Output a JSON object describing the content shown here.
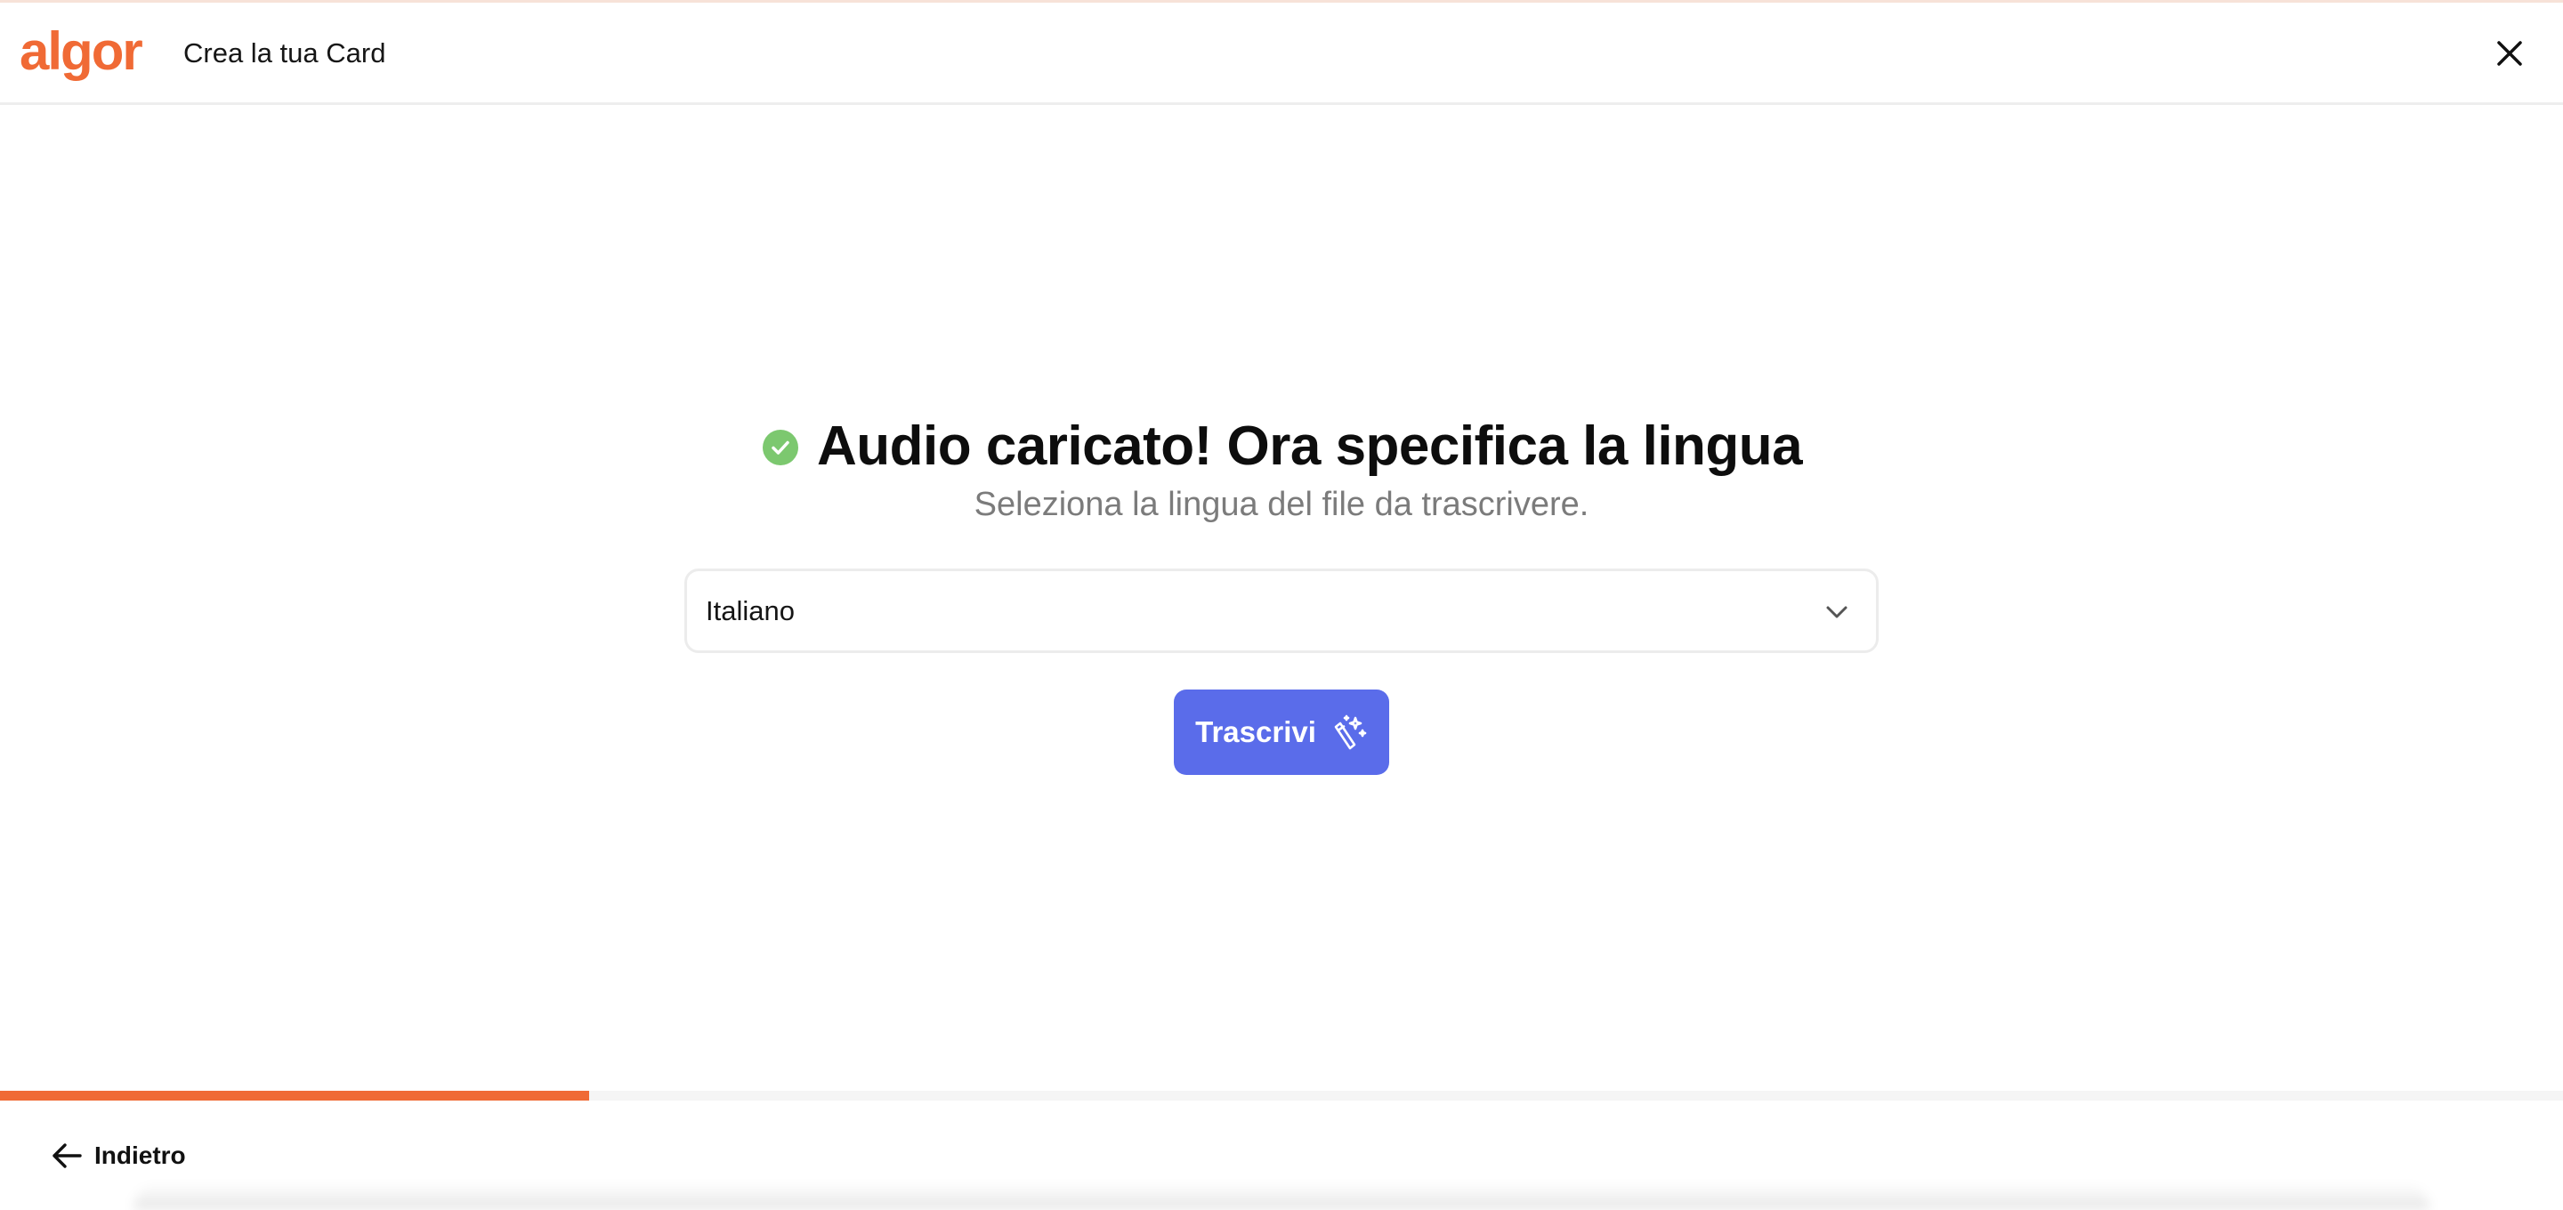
{
  "header": {
    "logo_text": "algor",
    "title": "Crea la tua Card",
    "close_icon": "close-icon"
  },
  "main": {
    "status_icon": "check-circle-icon",
    "title": "Audio caricato! Ora specifica la lingua",
    "subtitle": "Seleziona la lingua del file da trascrivere.",
    "language_select": {
      "selected": "Italiano",
      "icon": "chevron-down-icon"
    },
    "transcribe_button": {
      "label": "Trascrivi",
      "icon": "magic-wand-icon"
    }
  },
  "progress": {
    "fraction": 0.23
  },
  "footer": {
    "back_label": "Indietro",
    "back_icon": "arrow-left-icon"
  },
  "colors": {
    "brand_orange": "#f06a35",
    "button_blue": "#5a6cea",
    "success_green": "#7cc86f"
  }
}
